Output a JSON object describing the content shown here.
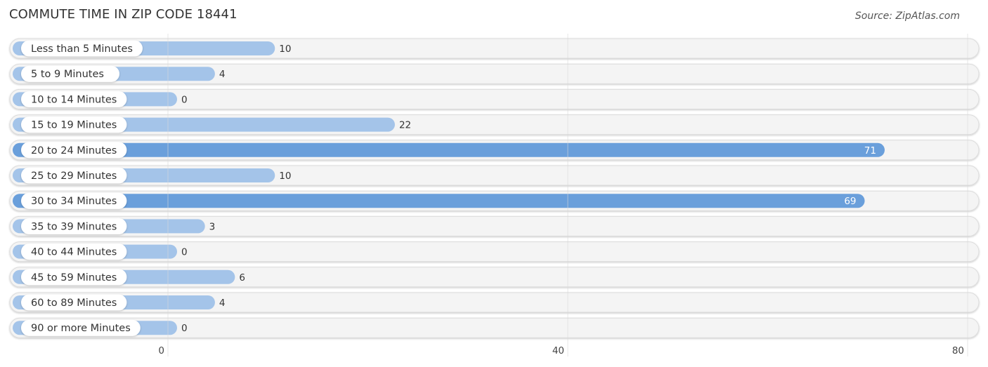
{
  "chart_data": {
    "type": "bar",
    "orientation": "horizontal",
    "title": "COMMUTE TIME IN ZIP CODE 18441",
    "source": "Source: ZipAtlas.com",
    "categories": [
      "Less than 5 Minutes",
      "5 to 9 Minutes",
      "10 to 14 Minutes",
      "15 to 19 Minutes",
      "20 to 24 Minutes",
      "25 to 29 Minutes",
      "30 to 34 Minutes",
      "35 to 39 Minutes",
      "40 to 44 Minutes",
      "45 to 59 Minutes",
      "60 to 89 Minutes",
      "90 or more Minutes"
    ],
    "values": [
      10,
      4,
      0,
      22,
      71,
      10,
      69,
      3,
      0,
      6,
      4,
      0
    ],
    "xlabel": "",
    "ylabel": "",
    "xlim": [
      0,
      80
    ],
    "xticks": [
      0,
      40,
      80
    ],
    "grid": true,
    "colors": {
      "bar_normal": "#a4c4e9",
      "bar_highlight": "#6a9fdb",
      "track": "#f4f4f4",
      "label_pill": "#ffffff"
    },
    "highlight_threshold": 50
  }
}
